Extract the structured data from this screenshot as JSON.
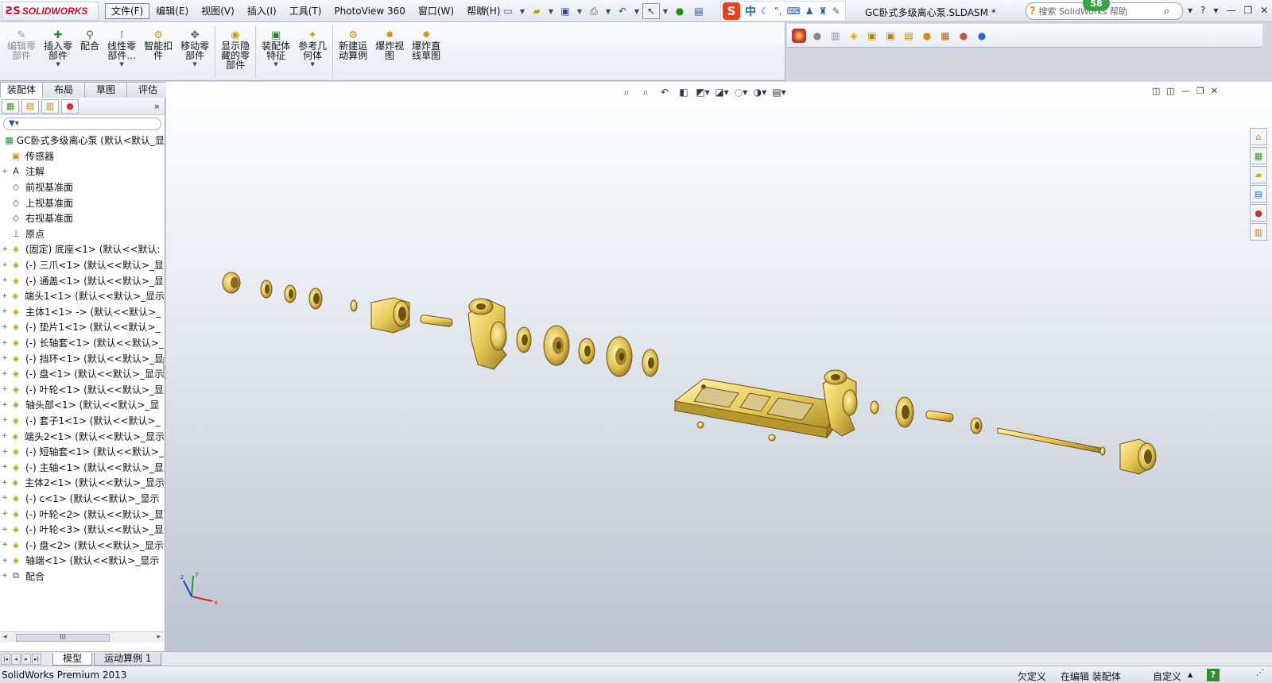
{
  "app": {
    "brand_mark": "ƧS",
    "brand_name": "SOLIDWORKS",
    "doc_title": "GC卧式多级离心泵.SLDASM *",
    "search_placeholder": "搜索 SolidWorks 帮助",
    "notification_count": "58",
    "help_label": "?"
  },
  "menu": [
    {
      "label": "文件(F)",
      "active": true
    },
    {
      "label": "编辑(E)"
    },
    {
      "label": "视图(V)"
    },
    {
      "label": "插入(I)"
    },
    {
      "label": "工具(T)"
    },
    {
      "label": "PhotoView 360"
    },
    {
      "label": "窗口(W)"
    },
    {
      "label": "帮助(H)"
    }
  ],
  "ime": {
    "logo": "S",
    "mode": "中"
  },
  "command_manager": [
    {
      "label": "编辑零\n部件",
      "icon": "edit-component-icon",
      "disabled": true,
      "dropdown": false
    },
    {
      "label": "插入零\n部件",
      "icon": "insert-component-icon",
      "dropdown": true
    },
    {
      "label": "配合",
      "icon": "mate-icon",
      "dropdown": false
    },
    {
      "label": "线性零\n部件...",
      "icon": "linear-pattern-icon",
      "dropdown": true
    },
    {
      "label": "智能扣\n件",
      "icon": "smart-fastener-icon",
      "dropdown": false
    },
    {
      "label": "移动零\n部件",
      "icon": "move-component-icon",
      "dropdown": true
    },
    {
      "label": "显示隐\n藏的零\n部件",
      "icon": "show-hidden-icon",
      "dropdown": false
    },
    {
      "label": "装配体\n特征",
      "icon": "assembly-feature-icon",
      "dropdown": true
    },
    {
      "label": "参考几\n何体",
      "icon": "reference-geometry-icon",
      "dropdown": true
    },
    {
      "label": "新建运\n动算例",
      "icon": "motion-study-icon",
      "dropdown": false
    },
    {
      "label": "爆炸视\n图",
      "icon": "exploded-view-icon",
      "dropdown": false
    },
    {
      "label": "爆炸直\n线草图",
      "icon": "explode-line-icon",
      "dropdown": false
    }
  ],
  "tabs": [
    "装配体",
    "布局",
    "草图",
    "评估"
  ],
  "tree": [
    {
      "label": "GC卧式多级离心泵  (默认<默认_显",
      "icon": "assembly-icon",
      "expand": ""
    },
    {
      "label": "传感器",
      "icon": "sensor-icon",
      "expand": ""
    },
    {
      "label": "注解",
      "icon": "annotation-icon",
      "expand": "+"
    },
    {
      "label": "前视基准面",
      "icon": "plane-icon",
      "expand": ""
    },
    {
      "label": "上视基准面",
      "icon": "plane-icon",
      "expand": ""
    },
    {
      "label": "右视基准面",
      "icon": "plane-icon",
      "expand": ""
    },
    {
      "label": "原点",
      "icon": "origin-icon",
      "expand": ""
    },
    {
      "label": "(固定) 底座<1> (默认<<默认:",
      "icon": "part-icon",
      "expand": "+"
    },
    {
      "label": "(-) 三爪<1> (默认<<默认>_显",
      "icon": "part-icon",
      "expand": "+"
    },
    {
      "label": "(-) 通盖<1> (默认<<默认>_显",
      "icon": "part-icon",
      "expand": "+"
    },
    {
      "label": "端头1<1> (默认<<默认>_显示",
      "icon": "part-icon",
      "expand": "+"
    },
    {
      "label": "主体1<1> -> (默认<<默认>_",
      "icon": "part-icon",
      "expand": "+"
    },
    {
      "label": "(-) 垫片1<1> (默认<<默认>_",
      "icon": "part-icon",
      "expand": "+"
    },
    {
      "label": "(-) 长轴套<1> (默认<<默认>_",
      "icon": "part-icon",
      "expand": "+"
    },
    {
      "label": "(-) 挡环<1> (默认<<默认>_显",
      "icon": "part-icon",
      "expand": "+"
    },
    {
      "label": "(-) 盘<1> (默认<<默认>_显示",
      "icon": "part-icon",
      "expand": "+"
    },
    {
      "label": "(-) 叶轮<1> (默认<<默认>_显",
      "icon": "part-icon",
      "expand": "+"
    },
    {
      "label": "轴头部<1> (默认<<默认>_显",
      "icon": "part-icon",
      "expand": "+"
    },
    {
      "label": "(-) 套子1<1> (默认<<默认>_",
      "icon": "part-icon",
      "expand": "+"
    },
    {
      "label": "端头2<1> (默认<<默认>_显示",
      "icon": "part-icon",
      "expand": "+"
    },
    {
      "label": "(-) 短轴套<1> (默认<<默认>_",
      "icon": "part-icon",
      "expand": "+"
    },
    {
      "label": "(-) 主轴<1> (默认<<默认>_显",
      "icon": "part-icon",
      "expand": "+"
    },
    {
      "label": "主体2<1> (默认<<默认>_显示",
      "icon": "part-icon",
      "expand": "+"
    },
    {
      "label": "(-) c<1> (默认<<默认>_显示",
      "icon": "part-icon",
      "expand": "+"
    },
    {
      "label": "(-) 叶轮<2> (默认<<默认>_显",
      "icon": "part-icon",
      "expand": "+"
    },
    {
      "label": "(-) 叶轮<3> (默认<<默认>_显",
      "icon": "part-icon",
      "expand": "+"
    },
    {
      "label": "(-) 盘<2> (默认<<默认>_显示",
      "icon": "part-icon",
      "expand": "+"
    },
    {
      "label": "轴端<1> (默认<<默认>_显示",
      "icon": "part-icon",
      "expand": "+"
    },
    {
      "label": "配合",
      "icon": "mates-icon",
      "expand": "+"
    }
  ],
  "bottom_tabs": [
    "模型",
    "运动算例 1"
  ],
  "status": {
    "product": "SolidWorks Premium 2013",
    "definition": "欠定义",
    "mode": "在编辑 装配体",
    "units": "自定义"
  },
  "colors": {
    "part": "#e8cf62",
    "part_dark": "#b8962e"
  }
}
